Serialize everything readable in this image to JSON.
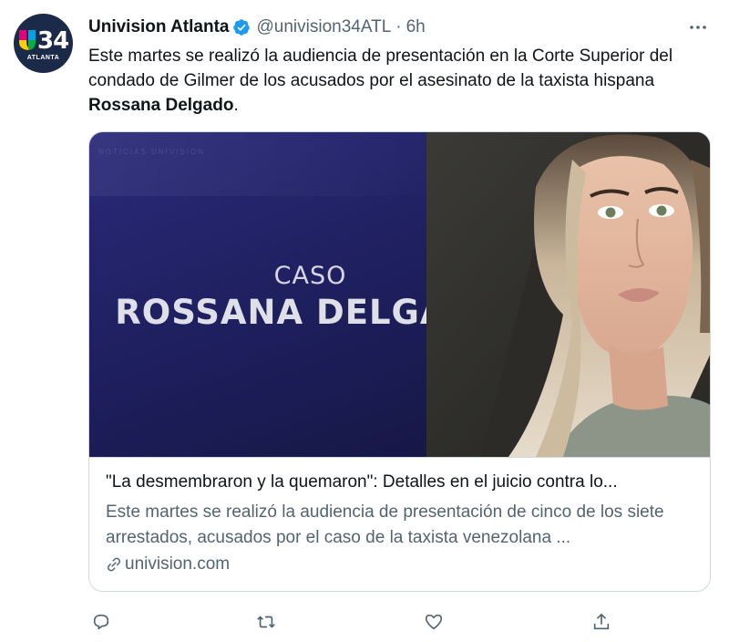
{
  "account": {
    "avatar_number": "34",
    "avatar_subtitle": "ATLANTA",
    "name": "Univision Atlanta",
    "handle": "@univision34ATL",
    "separator": "·",
    "time": "6h"
  },
  "tweet": {
    "text_before": "Este martes se realizó la audiencia de presentación en la Corte Superior del condado de Gilmer de los acusados por el asesinato de la taxista hispana ",
    "text_bold": "Rossana Delgado",
    "text_after": "."
  },
  "card": {
    "image_line1": "CASO",
    "image_line2": "ROSSANA DELGADO",
    "image_watermark": "NOTICIAS UNIVISION",
    "title": "\"La desmembraron y la quemaron\": Detalles en el juicio contra lo...",
    "description": "Este martes se realizó la audiencia de presentación de cinco de los siete arrestados, acusados por el caso de la taxista venezolana ...",
    "domain": "univision.com"
  },
  "icons": {
    "verified": "verified-badge-icon",
    "more": "more-icon",
    "reply": "reply-icon",
    "retweet": "retweet-icon",
    "like": "like-icon",
    "share": "share-icon",
    "link": "link-icon"
  },
  "colors": {
    "verified_blue": "#1d9bf0",
    "text": "#0f1419",
    "secondary": "#536471",
    "border": "#cfd9de",
    "card_bg": "#1e1f5e"
  }
}
